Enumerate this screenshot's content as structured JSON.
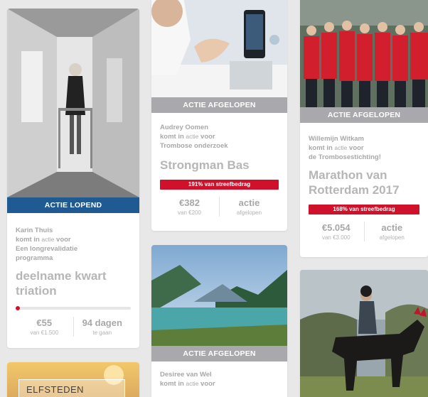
{
  "cards": [
    {
      "banner": "ACTIE LOPEND",
      "author": "Karin Thuis",
      "komt": "komt in",
      "actie": "actie",
      "voor": "voor",
      "cause_line1": "Een longrevalidatie",
      "cause_line2": "programma",
      "title": "deelname kwart triation",
      "progress_fraction": 0.04,
      "stat1_big": "€55",
      "stat1_sub": "van €1.500",
      "stat2_big": "94 dagen",
      "stat2_sub": "te gaan"
    },
    {
      "banner": "ACTIE AFGELOPEN",
      "author": "Audrey Oomen",
      "komt": "komt in",
      "actie": "actie",
      "voor": "voor",
      "cause_line1": "Trombose onderzoek",
      "title": "Strongman Bas",
      "pill": "191% van streefbedrag",
      "stat1_big": "€382",
      "stat1_sub": "van €200",
      "stat2_big": "actie",
      "stat2_sub": "afgelopen"
    },
    {
      "banner": "ACTIE AFGELOPEN",
      "author": "Willemijn Witkam",
      "komt": "komt in",
      "actie": "actie",
      "voor": "voor",
      "cause_line1": "de Trombosestichting!",
      "title": "Marathon van Rotterdam 2017",
      "pill": "168% van streefbedrag",
      "stat1_big": "€5.054",
      "stat1_sub": "van €3.000",
      "stat2_big": "actie",
      "stat2_sub": "afgelopen"
    },
    {
      "banner": "ACTIE AFGELOPEN",
      "author": "Desiree van Wel",
      "komt": "komt in",
      "actie": "actie",
      "voor": "voor"
    },
    {
      "banner_text": "ELFSTEDEN"
    },
    {}
  ],
  "colors": {
    "live": "#1f5a93",
    "done": "#a9a9ad",
    "accent": "#d0112b"
  }
}
